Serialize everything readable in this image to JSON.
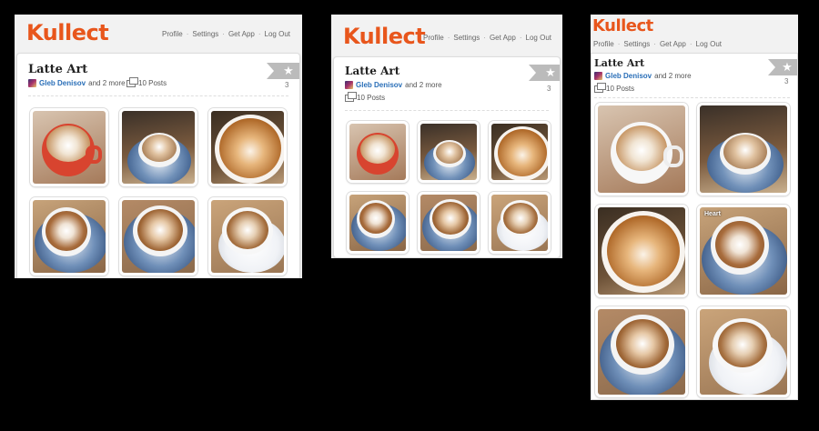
{
  "app": {
    "logo": "Kullect"
  },
  "nav": [
    {
      "label": "Profile"
    },
    {
      "label": "Settings"
    },
    {
      "label": "Get App"
    },
    {
      "label": "Log Out"
    }
  ],
  "collection": {
    "title": "Latte Art",
    "author": "Gleb Denisov",
    "collaborators": "and 2 more",
    "posts": "10 Posts",
    "favorite_count": "3"
  },
  "photo_caption": "Heart",
  "colors": {
    "brand": "#e8561c",
    "link": "#2a6fb8",
    "ribbon": "#bbbbbb"
  }
}
